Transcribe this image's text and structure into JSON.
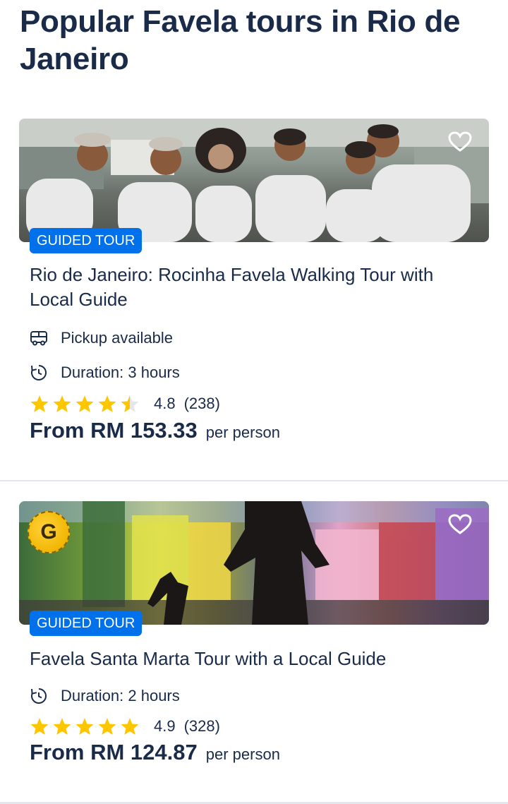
{
  "page": {
    "title": "Popular Favela tours in Rio de Janeiro"
  },
  "tours": [
    {
      "badge": "GUIDED TOUR",
      "title": "Rio de Janeiro: Rocinha Favela Walking Tour with Local Guide",
      "features": [
        {
          "icon": "bus-icon",
          "text": "Pickup available"
        },
        {
          "icon": "clock-history-icon",
          "text": "Duration: 3 hours"
        }
      ],
      "rating": {
        "score": "4.8",
        "count": "(238)",
        "stars": 4.5
      },
      "price": {
        "amount": "From RM 153.33",
        "unit": "per person"
      }
    },
    {
      "badge": "GUIDED TOUR",
      "title": "Favela Santa Marta Tour with a Local Guide",
      "logo_badge": "G",
      "features": [
        {
          "icon": "clock-history-icon",
          "text": "Duration: 2 hours"
        }
      ],
      "rating": {
        "score": "4.9",
        "count": "(328)",
        "stars": 5
      },
      "price": {
        "amount": "From RM 124.87",
        "unit": "per person"
      }
    }
  ],
  "colors": {
    "text": "#1a2b49",
    "badge": "#0071eb",
    "star": "#fdc700"
  }
}
